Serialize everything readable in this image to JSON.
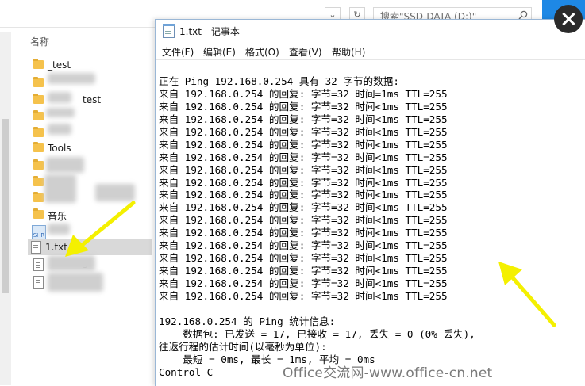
{
  "explorer": {
    "search_placeholder": "搜索\"SSD-DATA (D:)\"",
    "column_header": "名称",
    "items": [
      {
        "label": "_test",
        "type": "folder"
      },
      {
        "label": "",
        "type": "folder"
      },
      {
        "label": "test",
        "type": "folder"
      },
      {
        "label": "",
        "type": "folder"
      },
      {
        "label": "",
        "type": "folder"
      },
      {
        "label": "Tools",
        "type": "folder"
      },
      {
        "label": "",
        "type": "folder"
      },
      {
        "label": "",
        "type": "folder"
      },
      {
        "label": "",
        "type": "folder"
      },
      {
        "label": "音乐",
        "type": "folder"
      },
      {
        "label": "",
        "type": "shr"
      },
      {
        "label": "1.txt",
        "type": "txt",
        "selected": true
      },
      {
        "label": "s",
        "type": "doc"
      },
      {
        "label": "",
        "type": "doc"
      }
    ]
  },
  "notepad": {
    "title": "1.txt - 记事本",
    "menu": [
      "文件(F)",
      "编辑(E)",
      "格式(O)",
      "查看(V)",
      "帮助(H)"
    ],
    "lines": [
      "正在 Ping 192.168.0.254 具有 32 字节的数据:",
      "来自 192.168.0.254 的回复: 字节=32 时间=1ms TTL=255",
      "来自 192.168.0.254 的回复: 字节=32 时间<1ms TTL=255",
      "来自 192.168.0.254 的回复: 字节=32 时间<1ms TTL=255",
      "来自 192.168.0.254 的回复: 字节=32 时间<1ms TTL=255",
      "来自 192.168.0.254 的回复: 字节=32 时间<1ms TTL=255",
      "来自 192.168.0.254 的回复: 字节=32 时间<1ms TTL=255",
      "来自 192.168.0.254 的回复: 字节=32 时间<1ms TTL=255",
      "来自 192.168.0.254 的回复: 字节=32 时间<1ms TTL=255",
      "来自 192.168.0.254 的回复: 字节=32 时间<1ms TTL=255",
      "来自 192.168.0.254 的回复: 字节=32 时间<1ms TTL=255",
      "来自 192.168.0.254 的回复: 字节=32 时间<1ms TTL=255",
      "来自 192.168.0.254 的回复: 字节=32 时间<1ms TTL=255",
      "来自 192.168.0.254 的回复: 字节=32 时间<1ms TTL=255",
      "来自 192.168.0.254 的回复: 字节=32 时间<1ms TTL=255",
      "来自 192.168.0.254 的回复: 字节=32 时间<1ms TTL=255",
      "来自 192.168.0.254 的回复: 字节=32 时间<1ms TTL=255",
      "来自 192.168.0.254 的回复: 字节=32 时间<1ms TTL=255",
      "",
      "192.168.0.254 的 Ping 统计信息:",
      "    数据包: 已发送 = 17, 已接收 = 17, 丢失 = 0 (0% 丢失),",
      "往返行程的估计时间(以毫秒为单位):",
      "    最短 = 0ms, 最长 = 1ms, 平均 = 0ms",
      "Control-C"
    ]
  },
  "watermark": "Office交流网-www.office-cn.net",
  "colors": {
    "accent_blue": "#1e88e5",
    "arrow_yellow": "#f4f000",
    "close_bg": "#2b2b2b"
  },
  "icons": [
    "search-icon",
    "close-icon",
    "folder-icon",
    "text-file-icon",
    "notepad-icon",
    "arrow-annotation"
  ]
}
